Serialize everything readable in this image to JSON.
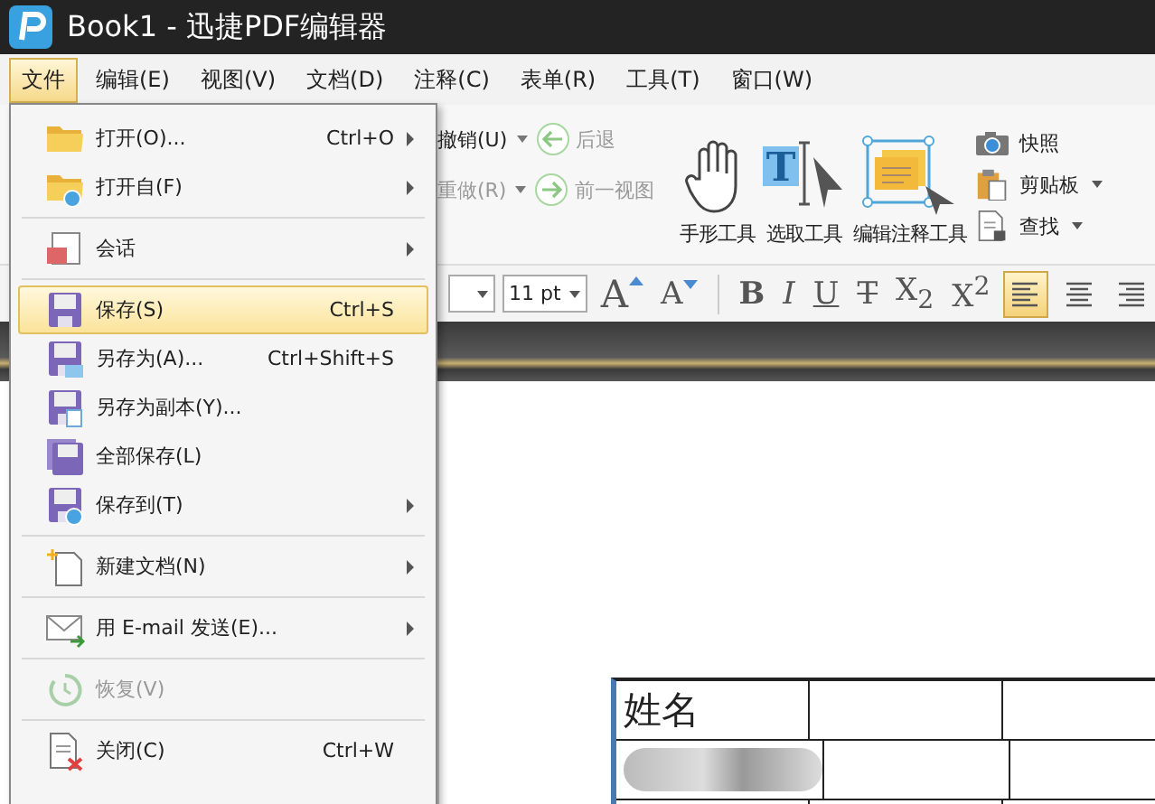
{
  "window": {
    "title": "Book1 - 迅捷PDF编辑器"
  },
  "menu_bar": [
    {
      "label": "文件",
      "selected": true
    },
    {
      "label": "编辑(E)",
      "selected": false
    },
    {
      "label": "视图(V)",
      "selected": false
    },
    {
      "label": "文档(D)",
      "selected": false
    },
    {
      "label": "注释(C)",
      "selected": false
    },
    {
      "label": "表单(R)",
      "selected": false
    },
    {
      "label": "工具(T)",
      "selected": false
    },
    {
      "label": "窗口(W)",
      "selected": false
    }
  ],
  "file_menu": [
    {
      "kind": "item",
      "label": "打开(O)...",
      "shortcut": "Ctrl+O",
      "submenu": true,
      "selected": false,
      "disabled": false
    },
    {
      "kind": "item",
      "label": "打开自(F)",
      "submenu": true,
      "selected": false,
      "disabled": false
    },
    {
      "kind": "separator"
    },
    {
      "kind": "item",
      "label": "会话",
      "submenu": true,
      "selected": false,
      "disabled": false
    },
    {
      "kind": "separator"
    },
    {
      "kind": "item",
      "label": "保存(S)",
      "shortcut": "Ctrl+S",
      "submenu": false,
      "selected": true,
      "disabled": false
    },
    {
      "kind": "item",
      "label": "另存为(A)...",
      "shortcut": "Ctrl+Shift+S",
      "submenu": false,
      "selected": false,
      "disabled": false
    },
    {
      "kind": "item",
      "label": "另存为副本(Y)...",
      "submenu": false,
      "selected": false,
      "disabled": false
    },
    {
      "kind": "item",
      "label": "全部保存(L)",
      "submenu": false,
      "selected": false,
      "disabled": false
    },
    {
      "kind": "item",
      "label": "保存到(T)",
      "submenu": true,
      "selected": false,
      "disabled": false
    },
    {
      "kind": "separator"
    },
    {
      "kind": "item",
      "label": "新建文档(N)",
      "submenu": true,
      "selected": false,
      "disabled": false
    },
    {
      "kind": "separator"
    },
    {
      "kind": "item",
      "label": "用 E-mail 发送(E)...",
      "submenu": true,
      "selected": false,
      "disabled": false
    },
    {
      "kind": "separator"
    },
    {
      "kind": "item",
      "label": "恢复(V)",
      "submenu": false,
      "selected": false,
      "disabled": true
    },
    {
      "kind": "separator"
    },
    {
      "kind": "item",
      "label": "关闭(C)",
      "shortcut": "Ctrl+W",
      "submenu": false,
      "selected": false,
      "disabled": false
    }
  ],
  "ribbon": {
    "history": [
      {
        "label": "撤销(U)",
        "disabled": false
      },
      {
        "label": "重做(R)",
        "disabled": true
      }
    ],
    "navigation": [
      {
        "label": "后退",
        "disabled": true
      },
      {
        "label": "前一视图",
        "disabled": true
      }
    ],
    "tools": [
      {
        "label": "手形工具"
      },
      {
        "label": "选取工具",
        "icon_text": "T"
      },
      {
        "label": "编辑注释工具"
      }
    ],
    "side": [
      {
        "label": "快照",
        "dropdown": false
      },
      {
        "label": "剪贴板",
        "dropdown": true
      },
      {
        "label": "查找",
        "dropdown": true
      }
    ]
  },
  "format_bar": {
    "font_size": "11 pt",
    "grow": "A",
    "shrink": "A",
    "styles": [
      "B",
      "I",
      "U",
      "T",
      "X$_{2}$",
      "X$^{2}$"
    ],
    "align": [
      {
        "selected": true
      },
      {
        "selected": false
      },
      {
        "selected": false
      }
    ]
  },
  "document": {
    "table": {
      "first_cell": "姓名"
    }
  }
}
